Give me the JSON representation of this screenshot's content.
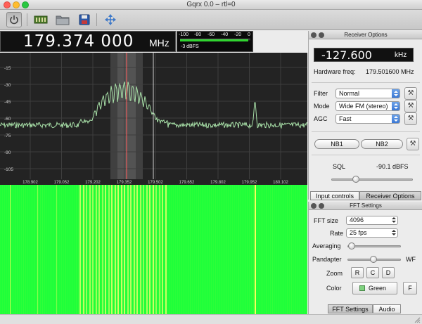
{
  "window": {
    "title": "Gqrx 0.0 – rtl=0"
  },
  "toolbar": {
    "buttons": [
      {
        "name": "power-icon"
      },
      {
        "name": "input-device-icon"
      },
      {
        "name": "folder-icon"
      },
      {
        "name": "save-icon"
      },
      {
        "name": "move-arrows-icon"
      }
    ]
  },
  "frequency": {
    "value": "179.374 000",
    "unit": "MHz"
  },
  "meter": {
    "ticks": [
      "-100",
      "-80",
      "-60",
      "-40",
      "-20",
      "0"
    ],
    "readout": "-3 dBFS",
    "level": 0.97,
    "color": "#2fd42f"
  },
  "spectrum": {
    "y_ticks": [
      "-15",
      "-30",
      "-45",
      "-60",
      "-75",
      "-90",
      "-105"
    ],
    "x_ticks": [
      "178.902",
      "179.052",
      "179.202",
      "179.352",
      "179.502",
      "179.652",
      "179.802",
      "179.952",
      "180.102"
    ],
    "background": "#232323",
    "trace_color": "#a8e0a8",
    "marker_color": "#ff5c5c",
    "waterfall_color": "#1fff3a"
  },
  "receiver": {
    "title": "Receiver Options",
    "offset": "-127.600",
    "offset_unit": "kHz",
    "hw_label": "Hardware freq:",
    "hw_value": "179.501600 MHz",
    "filter_label": "Filter",
    "filter_value": "Normal",
    "mode_label": "Mode",
    "mode_value": "Wide FM (stereo)",
    "agc_label": "AGC",
    "agc_value": "Fast",
    "nb1": "NB1",
    "nb2": "NB2",
    "sql_label": "SQL",
    "sql_value": "-90.1 dBFS",
    "tabs": [
      "Input controls",
      "Receiver Options"
    ]
  },
  "fft": {
    "title": "FFT Settings",
    "size_label": "FFT size",
    "size_value": "4096",
    "rate_label": "Rate",
    "rate_value": "25 fps",
    "averaging_label": "Averaging",
    "pandapter_label": "Pandapter",
    "wf_label": "WF",
    "zoom_label": "Zoom",
    "zoom_buttons": [
      "R",
      "C",
      "D"
    ],
    "color_label": "Color",
    "color_value": "Green",
    "color_swatch": "#7fd27f",
    "f_button": "F",
    "tabs": [
      "FFT Settings",
      "Audio"
    ]
  }
}
